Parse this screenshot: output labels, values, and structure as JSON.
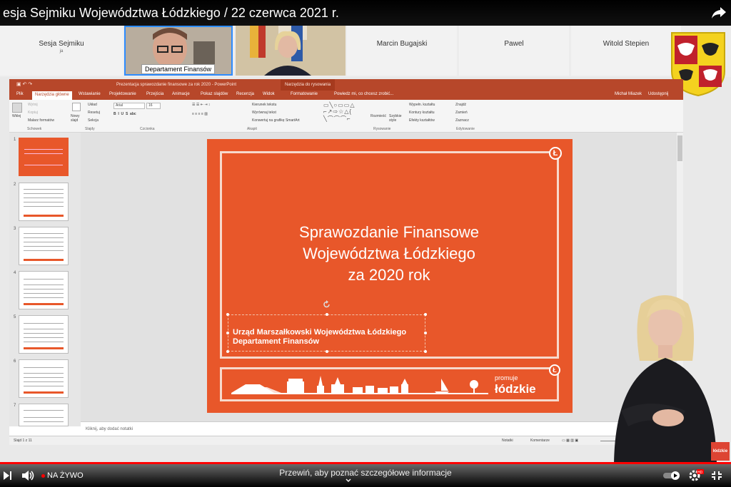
{
  "player": {
    "title": "esja Sejmiku Województwa Łódzkiego / 22 czerwca 2021 r.",
    "live_label": "NA ŻYWO",
    "hint": "Przewiń, aby poznać szczegółowe informacje"
  },
  "participants": [
    {
      "name": "Sesja Sejmiku",
      "sub": "ja"
    },
    {
      "name": "Marcin Bugajski",
      "sub": ""
    },
    {
      "name": "Pawel",
      "sub": ""
    },
    {
      "name": "Witold Stepien",
      "sub": ""
    }
  ],
  "video_badge": "Departament Finansów",
  "ppt": {
    "window_title": "Prezentacja sprawozdanie finansowe za rok 2020 - PowerPoint",
    "drawing_tools": "Narzędzia do rysowania",
    "tabs": [
      "Plik",
      "Narzędzia główne",
      "Wstawianie",
      "Projektowanie",
      "Przejścia",
      "Animacje",
      "Pokaz slajdów",
      "Recenzja",
      "Widok",
      "Formatowanie"
    ],
    "active_tab": "Narzędzia główne",
    "tell_me": "Powiedz mi, co chcesz zrobić...",
    "user": "Michał Miazek",
    "share": "Udostępnij",
    "ribbon": {
      "wklej": "Wklej",
      "wytnij": "Wytnij",
      "kopiuj": "Kopiuj",
      "malarz": "Malarz formatów",
      "nowy_slajd": "Nowy slajd",
      "uklad": "Układ",
      "resetuj": "Resetuj",
      "sekcja": "Sekcja",
      "font": "Arial",
      "size": "16",
      "kierunek": "Kierunek tekstu",
      "wyrownaj": "Wyrównaj tekst",
      "konwertuj": "Konwertuj na grafikę SmartArt",
      "rozmiesc": "Rozmieść",
      "szybkie": "Szybkie style",
      "wypelnienie": "Wypełn. kształtu",
      "kontury": "Kontury kształtu",
      "efekty": "Efekty kształtów",
      "znajdz": "Znajdź",
      "zamien": "Zamień",
      "zaznacz": "Zaznacz",
      "groups": [
        "Schowek",
        "Slajdy",
        "Czcionka",
        "Akapit",
        "Rysowanie",
        "Edytowanie"
      ]
    },
    "thumb_numbers": [
      "1",
      "2",
      "3",
      "4",
      "5",
      "6",
      "7"
    ],
    "notes_placeholder": "Kliknij, aby dodać notatki",
    "status_slide": "Slajd 1 z 11",
    "status_notes": "Notatki",
    "status_comments": "Komentarze"
  },
  "slide": {
    "title_lines": [
      "Sprawozdanie Finansowe",
      "Województwa Łódzkiego",
      "za 2020 rok"
    ],
    "subtitle_lines": [
      "Urząd Marszałkowski Województwa Łódzkiego",
      "Departament Finansów"
    ],
    "brand_small": "promuje",
    "brand_big": "łódzkie",
    "logo_letter": "Ł"
  },
  "brand_badge": "łódzkie",
  "colors": {
    "slide_orange": "#e8572a",
    "ppt_red": "#b7472a",
    "live_red": "#ff0000"
  }
}
